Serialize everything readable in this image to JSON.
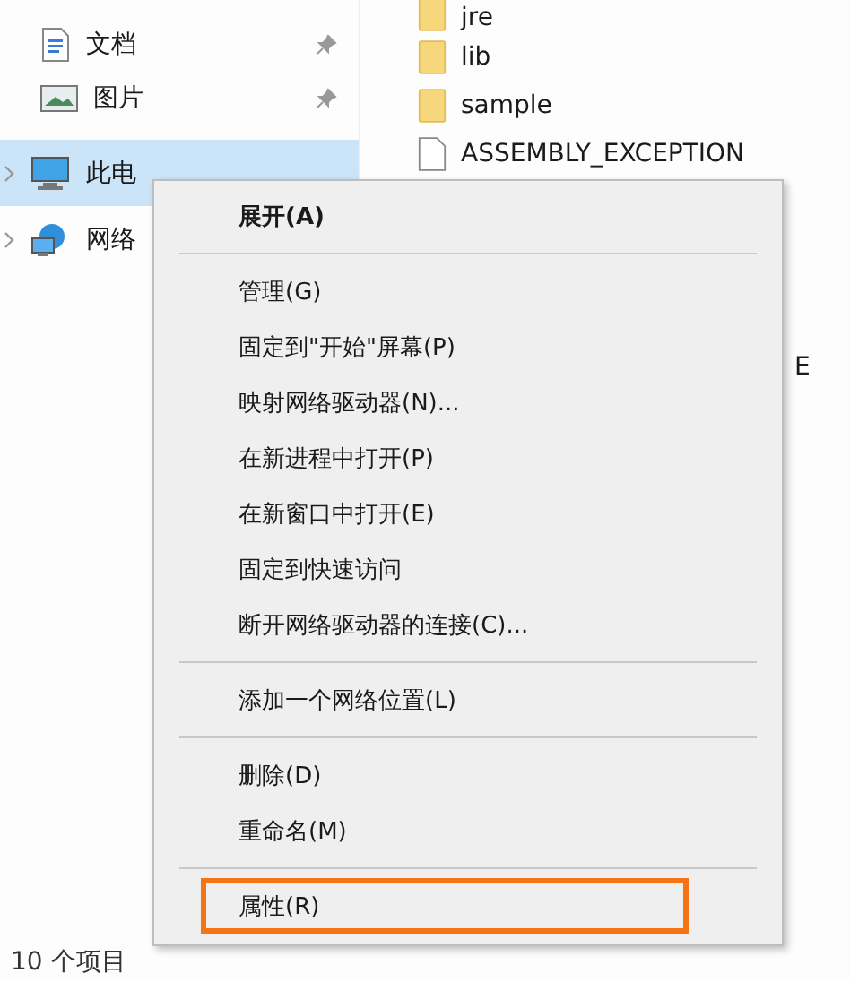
{
  "nav": [
    {
      "label": "文档",
      "kind": "document",
      "pinned": true,
      "selected": false,
      "expandable": false
    },
    {
      "label": "图片",
      "kind": "picture",
      "pinned": true,
      "selected": false,
      "expandable": false
    },
    {
      "label": "此电",
      "kind": "computer",
      "pinned": false,
      "selected": true,
      "expandable": true
    },
    {
      "label": "网络",
      "kind": "network",
      "pinned": false,
      "selected": false,
      "expandable": true
    }
  ],
  "files": [
    {
      "name": "jre",
      "kind": "folder"
    },
    {
      "name": "lib",
      "kind": "folder"
    },
    {
      "name": "sample",
      "kind": "folder"
    },
    {
      "name": "ASSEMBLY_EXCEPTION",
      "kind": "file"
    }
  ],
  "hidden_file_tail": "E",
  "context_menu": [
    {
      "kind": "item",
      "label": "展开(A)",
      "default": true,
      "highlighted": false
    },
    {
      "kind": "separator"
    },
    {
      "kind": "item",
      "label": "管理(G)",
      "default": false,
      "highlighted": false
    },
    {
      "kind": "item",
      "label": "固定到\"开始\"屏幕(P)",
      "default": false,
      "highlighted": false
    },
    {
      "kind": "item",
      "label": "映射网络驱动器(N)...",
      "default": false,
      "highlighted": false
    },
    {
      "kind": "item",
      "label": "在新进程中打开(P)",
      "default": false,
      "highlighted": false
    },
    {
      "kind": "item",
      "label": "在新窗口中打开(E)",
      "default": false,
      "highlighted": false
    },
    {
      "kind": "item",
      "label": "固定到快速访问",
      "default": false,
      "highlighted": false
    },
    {
      "kind": "item",
      "label": "断开网络驱动器的连接(C)...",
      "default": false,
      "highlighted": false
    },
    {
      "kind": "separator"
    },
    {
      "kind": "item",
      "label": "添加一个网络位置(L)",
      "default": false,
      "highlighted": false
    },
    {
      "kind": "separator"
    },
    {
      "kind": "item",
      "label": "删除(D)",
      "default": false,
      "highlighted": false
    },
    {
      "kind": "item",
      "label": "重命名(M)",
      "default": false,
      "highlighted": false
    },
    {
      "kind": "separator"
    },
    {
      "kind": "item",
      "label": "属性(R)",
      "default": false,
      "highlighted": true
    }
  ],
  "status_bar": {
    "count": "10 个项目"
  }
}
